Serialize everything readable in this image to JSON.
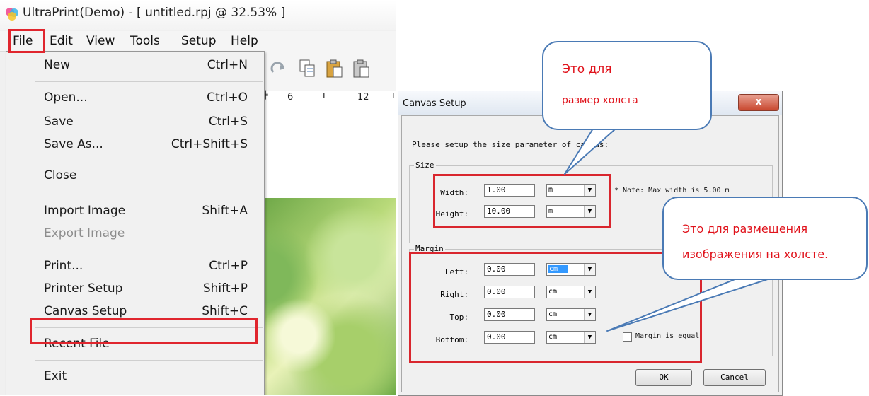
{
  "window": {
    "title": "UltraPrint(Demo) - [ untitled.rpj @ 32.53% ]"
  },
  "menubar": {
    "items": [
      "File",
      "Edit",
      "View",
      "Tools",
      "Setup",
      "Help"
    ]
  },
  "ruler": {
    "ticks": [
      "6",
      "12"
    ]
  },
  "file_menu": {
    "items": [
      {
        "label": "New",
        "shortcut": "Ctrl+N"
      },
      {
        "label": "Open...",
        "shortcut": "Ctrl+O"
      },
      {
        "label": "Save",
        "shortcut": "Ctrl+S"
      },
      {
        "label": "Save As...",
        "shortcut": "Ctrl+Shift+S"
      },
      {
        "label": "Close",
        "shortcut": ""
      },
      {
        "label": "Import Image",
        "shortcut": "Shift+A"
      },
      {
        "label": "Export Image",
        "shortcut": ""
      },
      {
        "label": "Print...",
        "shortcut": "Ctrl+P"
      },
      {
        "label": "Printer Setup",
        "shortcut": "Shift+P"
      },
      {
        "label": "Canvas Setup",
        "shortcut": "Shift+C"
      },
      {
        "label": "Recent File",
        "shortcut": ""
      },
      {
        "label": "Exit",
        "shortcut": ""
      }
    ]
  },
  "dialog": {
    "title": "Canvas Setup",
    "close_label": "x",
    "instruction": "Please setup the size parameter of canvas:",
    "size_group": "Size",
    "width_label": "Width:",
    "width_value": "1.00",
    "width_unit": "m",
    "height_label": "Height:",
    "height_value": "10.00",
    "height_unit": "m",
    "note": "* Note: Max width is 5.00 m",
    "margin_group": "Margin",
    "left_label": "Left:",
    "left_value": "0.00",
    "left_unit": "cm",
    "right_label": "Right:",
    "right_value": "0.00",
    "right_unit": "cm",
    "top_label": "Top:",
    "top_value": "0.00",
    "top_unit": "cm",
    "bottom_label": "Bottom:",
    "bottom_value": "0.00",
    "bottom_unit": "cm",
    "margin_equal_label": "Margin is equal",
    "ok_label": "OK",
    "cancel_label": "Cancel"
  },
  "callouts": {
    "size_line1": "Это для",
    "size_line2": "размер холста",
    "margin_line1": "Это для размещения",
    "margin_line2": "изображения на холсте."
  },
  "colors": {
    "highlight_red": "#e0262e",
    "callout_border": "#4a7ab5",
    "callout_text": "#e0121b"
  }
}
